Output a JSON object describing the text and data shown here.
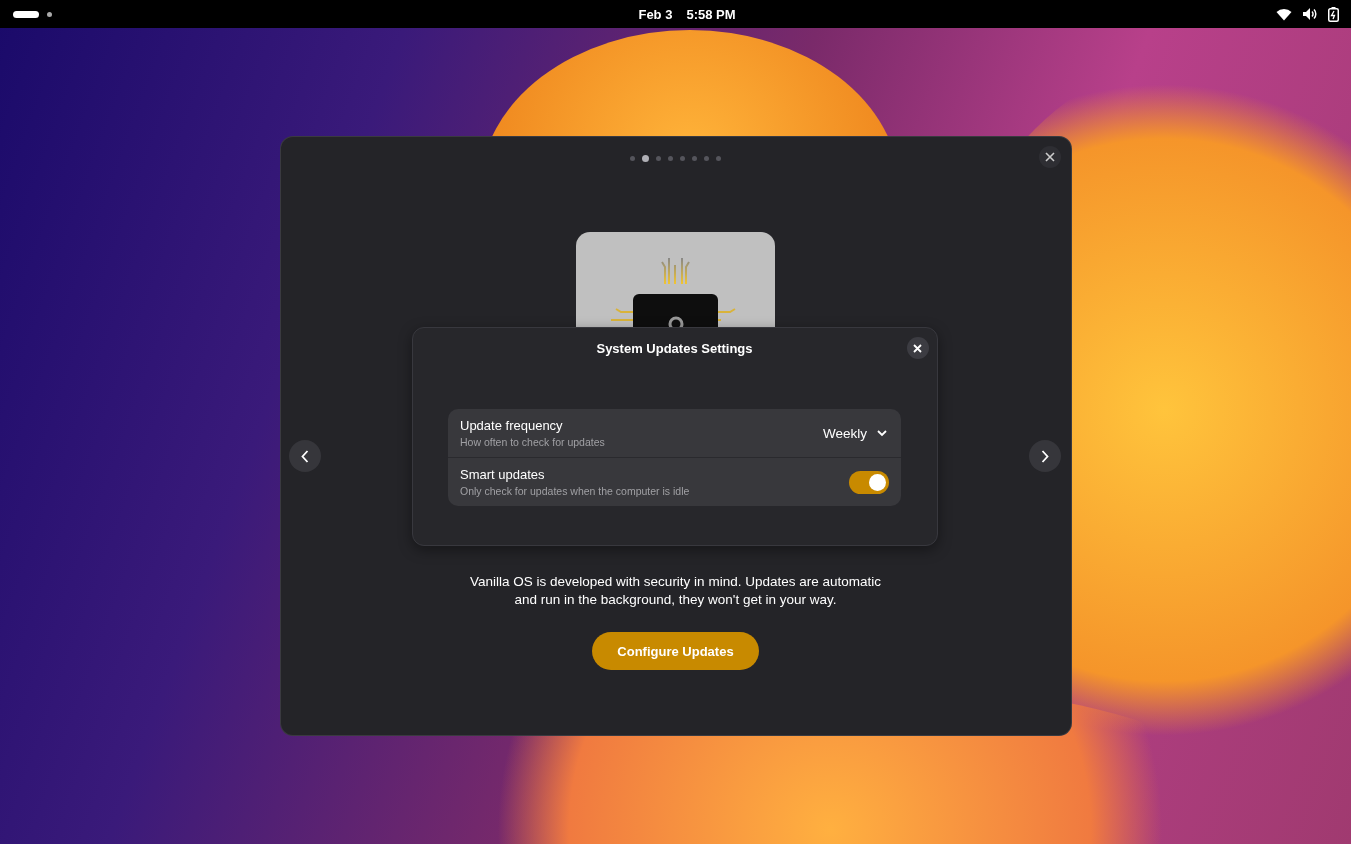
{
  "top_bar": {
    "date": "Feb 3",
    "time": "5:58 PM"
  },
  "carousel": {
    "pages": [
      {
        "selected": false
      },
      {
        "selected": true
      },
      {
        "selected": false
      },
      {
        "selected": false
      },
      {
        "selected": false
      },
      {
        "selected": false
      },
      {
        "selected": false
      },
      {
        "selected": false
      }
    ]
  },
  "dialog": {
    "title": "System Updates Settings",
    "rows": [
      {
        "kind": "dropdown",
        "title": "Update frequency",
        "subtitle": "How often to check for updates",
        "value": "Weekly"
      },
      {
        "kind": "switch",
        "title": "Smart updates",
        "subtitle": "Only check for updates when the computer is idle",
        "on": true
      }
    ]
  },
  "description": "Vanilla OS is developed with security in mind. Updates are automatic\nand run in the background, they won't get in your way.",
  "primary_button": "Configure Updates"
}
